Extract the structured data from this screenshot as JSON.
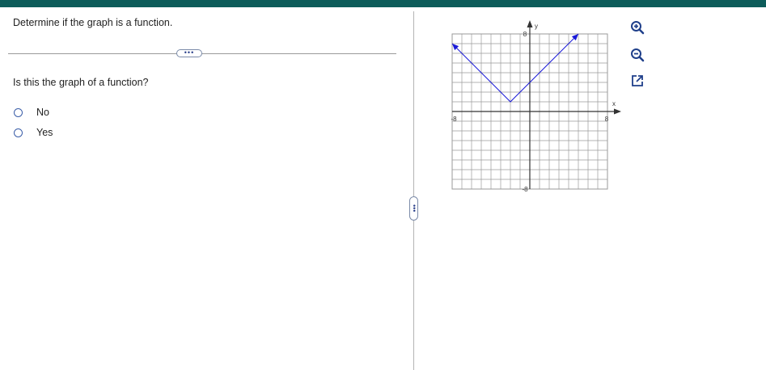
{
  "colors": {
    "header": "#0d5c5a",
    "grid": "#9a9a9a",
    "axis": "#333333",
    "curve": "#1a1ad8",
    "icon": "#1f3f8a"
  },
  "question": "Determine if the graph is a function.",
  "more_label": "•••",
  "sub_question": "Is this the graph of a function?",
  "options": [
    {
      "label": "No"
    },
    {
      "label": "Yes"
    }
  ],
  "graph": {
    "x_label": "x",
    "y_label": "y",
    "tick_labels": {
      "x_min": "-8",
      "x_max": "8",
      "y_max": "8",
      "y_min": "-8"
    },
    "x_range": [
      -8,
      8
    ],
    "y_range": [
      -8,
      8
    ],
    "curve_points": [
      [
        -8,
        7
      ],
      [
        -2,
        1
      ],
      [
        5,
        8
      ]
    ]
  },
  "icons": [
    "zoom-in-icon",
    "zoom-out-icon",
    "open-external-icon"
  ]
}
